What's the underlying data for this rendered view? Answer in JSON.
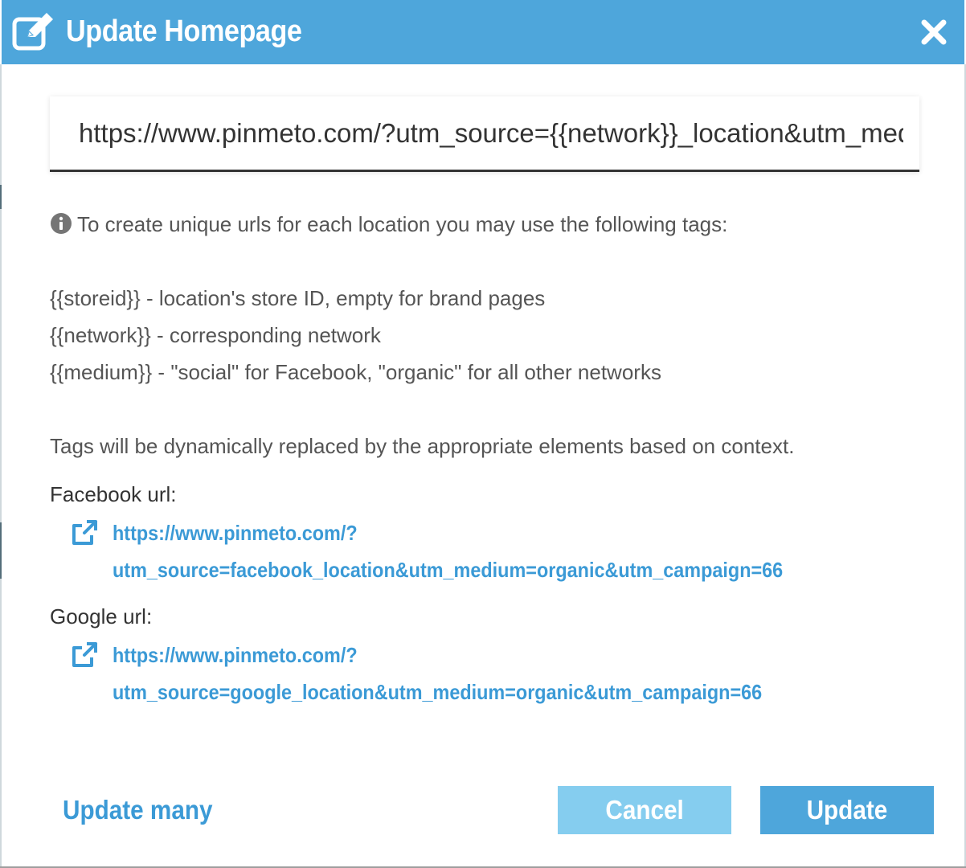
{
  "colors": {
    "header_bg": "#4ea6db",
    "link": "#3b9ad6",
    "cancel_bg": "#85cdef",
    "update_bg": "#4ea6db",
    "text": "#555555"
  },
  "dialog": {
    "title": "Update Homepage",
    "title_icon": "edit-icon",
    "close_icon": "close-icon"
  },
  "url_field": {
    "value": "https://www.pinmeto.com/?utm_source={{network}}_location&utm_medium={{medium}}&utm_campaign={{storeid}}"
  },
  "help": {
    "info_icon": "info-icon",
    "intro": "To create unique urls for each location you may use the following tags:",
    "tags": [
      "{{storeid}} - location's store ID, empty for brand pages",
      "{{network}} - corresponding network",
      "{{medium}} - \"social\" for Facebook, \"organic\" for all other networks"
    ],
    "note": "Tags will be dynamically replaced by the appropriate elements based on context."
  },
  "previews": [
    {
      "label": "Facebook url:",
      "icon": "external-link-icon",
      "line1": "https://www.pinmeto.com/?",
      "line2": "utm_source=facebook_location&utm_medium=organic&utm_campaign=66"
    },
    {
      "label": "Google url:",
      "icon": "external-link-icon",
      "line1": "https://www.pinmeto.com/?",
      "line2": "utm_source=google_location&utm_medium=organic&utm_campaign=66"
    }
  ],
  "footer": {
    "update_many": "Update many",
    "cancel": "Cancel",
    "update": "Update"
  }
}
